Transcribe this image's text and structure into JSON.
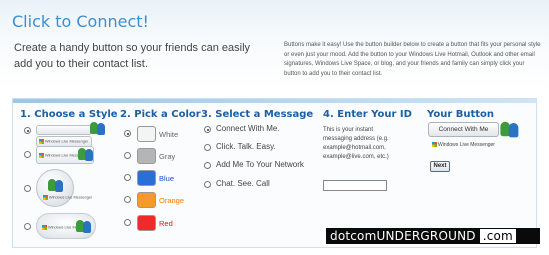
{
  "header": {
    "title": "Click to Connect!",
    "subtitle": "Create a handy button so your friends can easily add you to their contact list.",
    "intro": "Buttons make it easy! Use the button builder below to create a button that fits your personal style or even just your mood. Add the button to your Windows Live Hotmail, Outlook and other email signatures, Windows Live Space, or blog, and your friends and family can simply click your button to add you to their contact list."
  },
  "steps": {
    "style": {
      "heading": "1. Choose a Style",
      "options": [
        "wide-button",
        "wide-button-logo",
        "square-button",
        "round-orb",
        "cloud"
      ],
      "selected_index": 0
    },
    "color": {
      "heading": "2. Pick a Color",
      "options": [
        {
          "label": "White",
          "swatch": "#f4f4f4",
          "text_color": "#666666"
        },
        {
          "label": "Gray",
          "swatch": "#b5b5b5",
          "text_color": "#666666"
        },
        {
          "label": "Blue",
          "swatch": "#2b6fd6",
          "text_color": "#1f4fd0"
        },
        {
          "label": "Orange",
          "swatch": "#f39a2a",
          "text_color": "#f07f00"
        },
        {
          "label": "Red",
          "swatch": "#ee2a2a",
          "text_color": "#d91a1a"
        }
      ],
      "selected_index": 0
    },
    "message": {
      "heading": "3. Select a Message",
      "options": [
        "Connect With Me.",
        "Click. Talk. Easy.",
        "Add Me To Your Network",
        "Chat. See. Call"
      ],
      "selected_index": 0
    },
    "id": {
      "heading": "4. Enter Your ID",
      "description": "This is your instant messaging address (e.g. example@hotmail.com, example@live.com, etc.)",
      "value": ""
    },
    "preview": {
      "heading": "Your Button",
      "button_label": "Connect With Me",
      "brand_label": "Windows Live Messenger",
      "next_label": "Next"
    }
  },
  "thumbnail_brand": "Windows Live Messenger",
  "watermark": {
    "main": "dotcomUNDERGROUND",
    "suffix": ".com"
  }
}
